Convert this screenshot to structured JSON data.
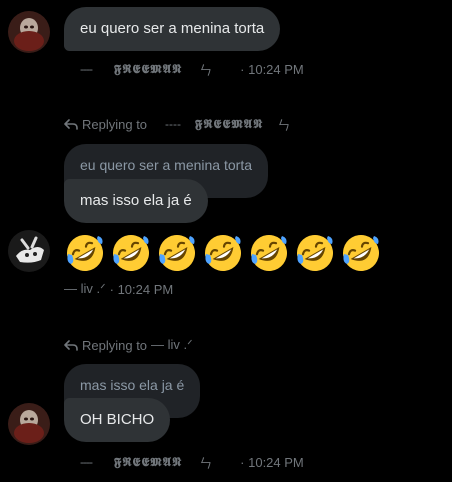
{
  "messages": [
    {
      "text": "eu quero ser a menina torta",
      "meta": {
        "prefix": "----",
        "username": "𝕱𝕽𝕰𝕰𝕸𝕬𝕹",
        "suffix": "ㄣ",
        "time": "· 10:24 PM"
      }
    }
  ],
  "reply1": {
    "label": "Replying to",
    "prefix": "----",
    "username": "𝕱𝕽𝕰𝕰𝕸𝕬𝕹",
    "suffix": "ㄣ",
    "quoted_text": "eu quero ser a menina torta",
    "message": "mas isso ela ja é",
    "emoji_count": 7,
    "meta": {
      "author": "— liv .ᐟ",
      "time": "· 10:24 PM"
    }
  },
  "reply2": {
    "label": "Replying to",
    "target": "— liv .ᐟ",
    "quoted_text": "mas isso ela ja é",
    "message": "OH BICHO",
    "meta": {
      "prefix": "----",
      "username": "𝕱𝕽𝕰𝕰𝕸𝕬𝕹",
      "suffix": "ㄣ",
      "time": "· 10:24 PM"
    }
  },
  "emoji": [
    "rolling-on-floor-laughing",
    "rolling-on-floor-laughing",
    "rolling-on-floor-laughing",
    "rolling-on-floor-laughing",
    "rolling-on-floor-laughing",
    "rolling-on-floor-laughing",
    "rolling-on-floor-laughing"
  ],
  "colors": {
    "background": "#000000",
    "bubble": "#2f3336",
    "quoted_bubble": "#202327",
    "muted_text": "#71767b",
    "text": "#e7e9ea"
  }
}
